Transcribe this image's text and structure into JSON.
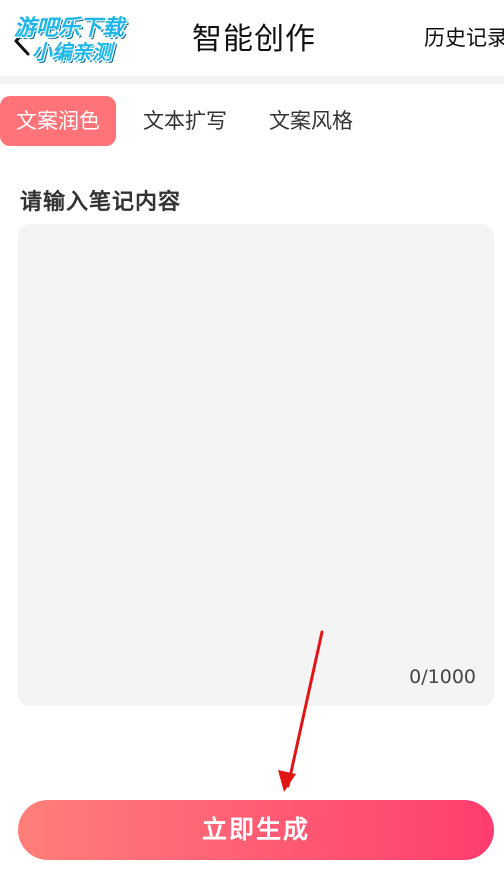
{
  "header": {
    "title": "智能创作",
    "history_label": "历史记录",
    "watermark_line1": "游吧乐下载",
    "watermark_line2": "小编亲测"
  },
  "tabs": [
    {
      "label": "文案润色",
      "active": true
    },
    {
      "label": "文本扩写",
      "active": false
    },
    {
      "label": "文案风格",
      "active": false
    }
  ],
  "form": {
    "section_label": "请输入笔记内容",
    "input_value": "",
    "char_count": "0/1000"
  },
  "actions": {
    "generate_label": "立即生成"
  },
  "colors": {
    "accent": "#ff7379",
    "button_gradient_start": "#ff7f7a",
    "button_gradient_end": "#ff3d6e",
    "annotation_arrow": "#e01616",
    "watermark": "#1fb6e8"
  }
}
